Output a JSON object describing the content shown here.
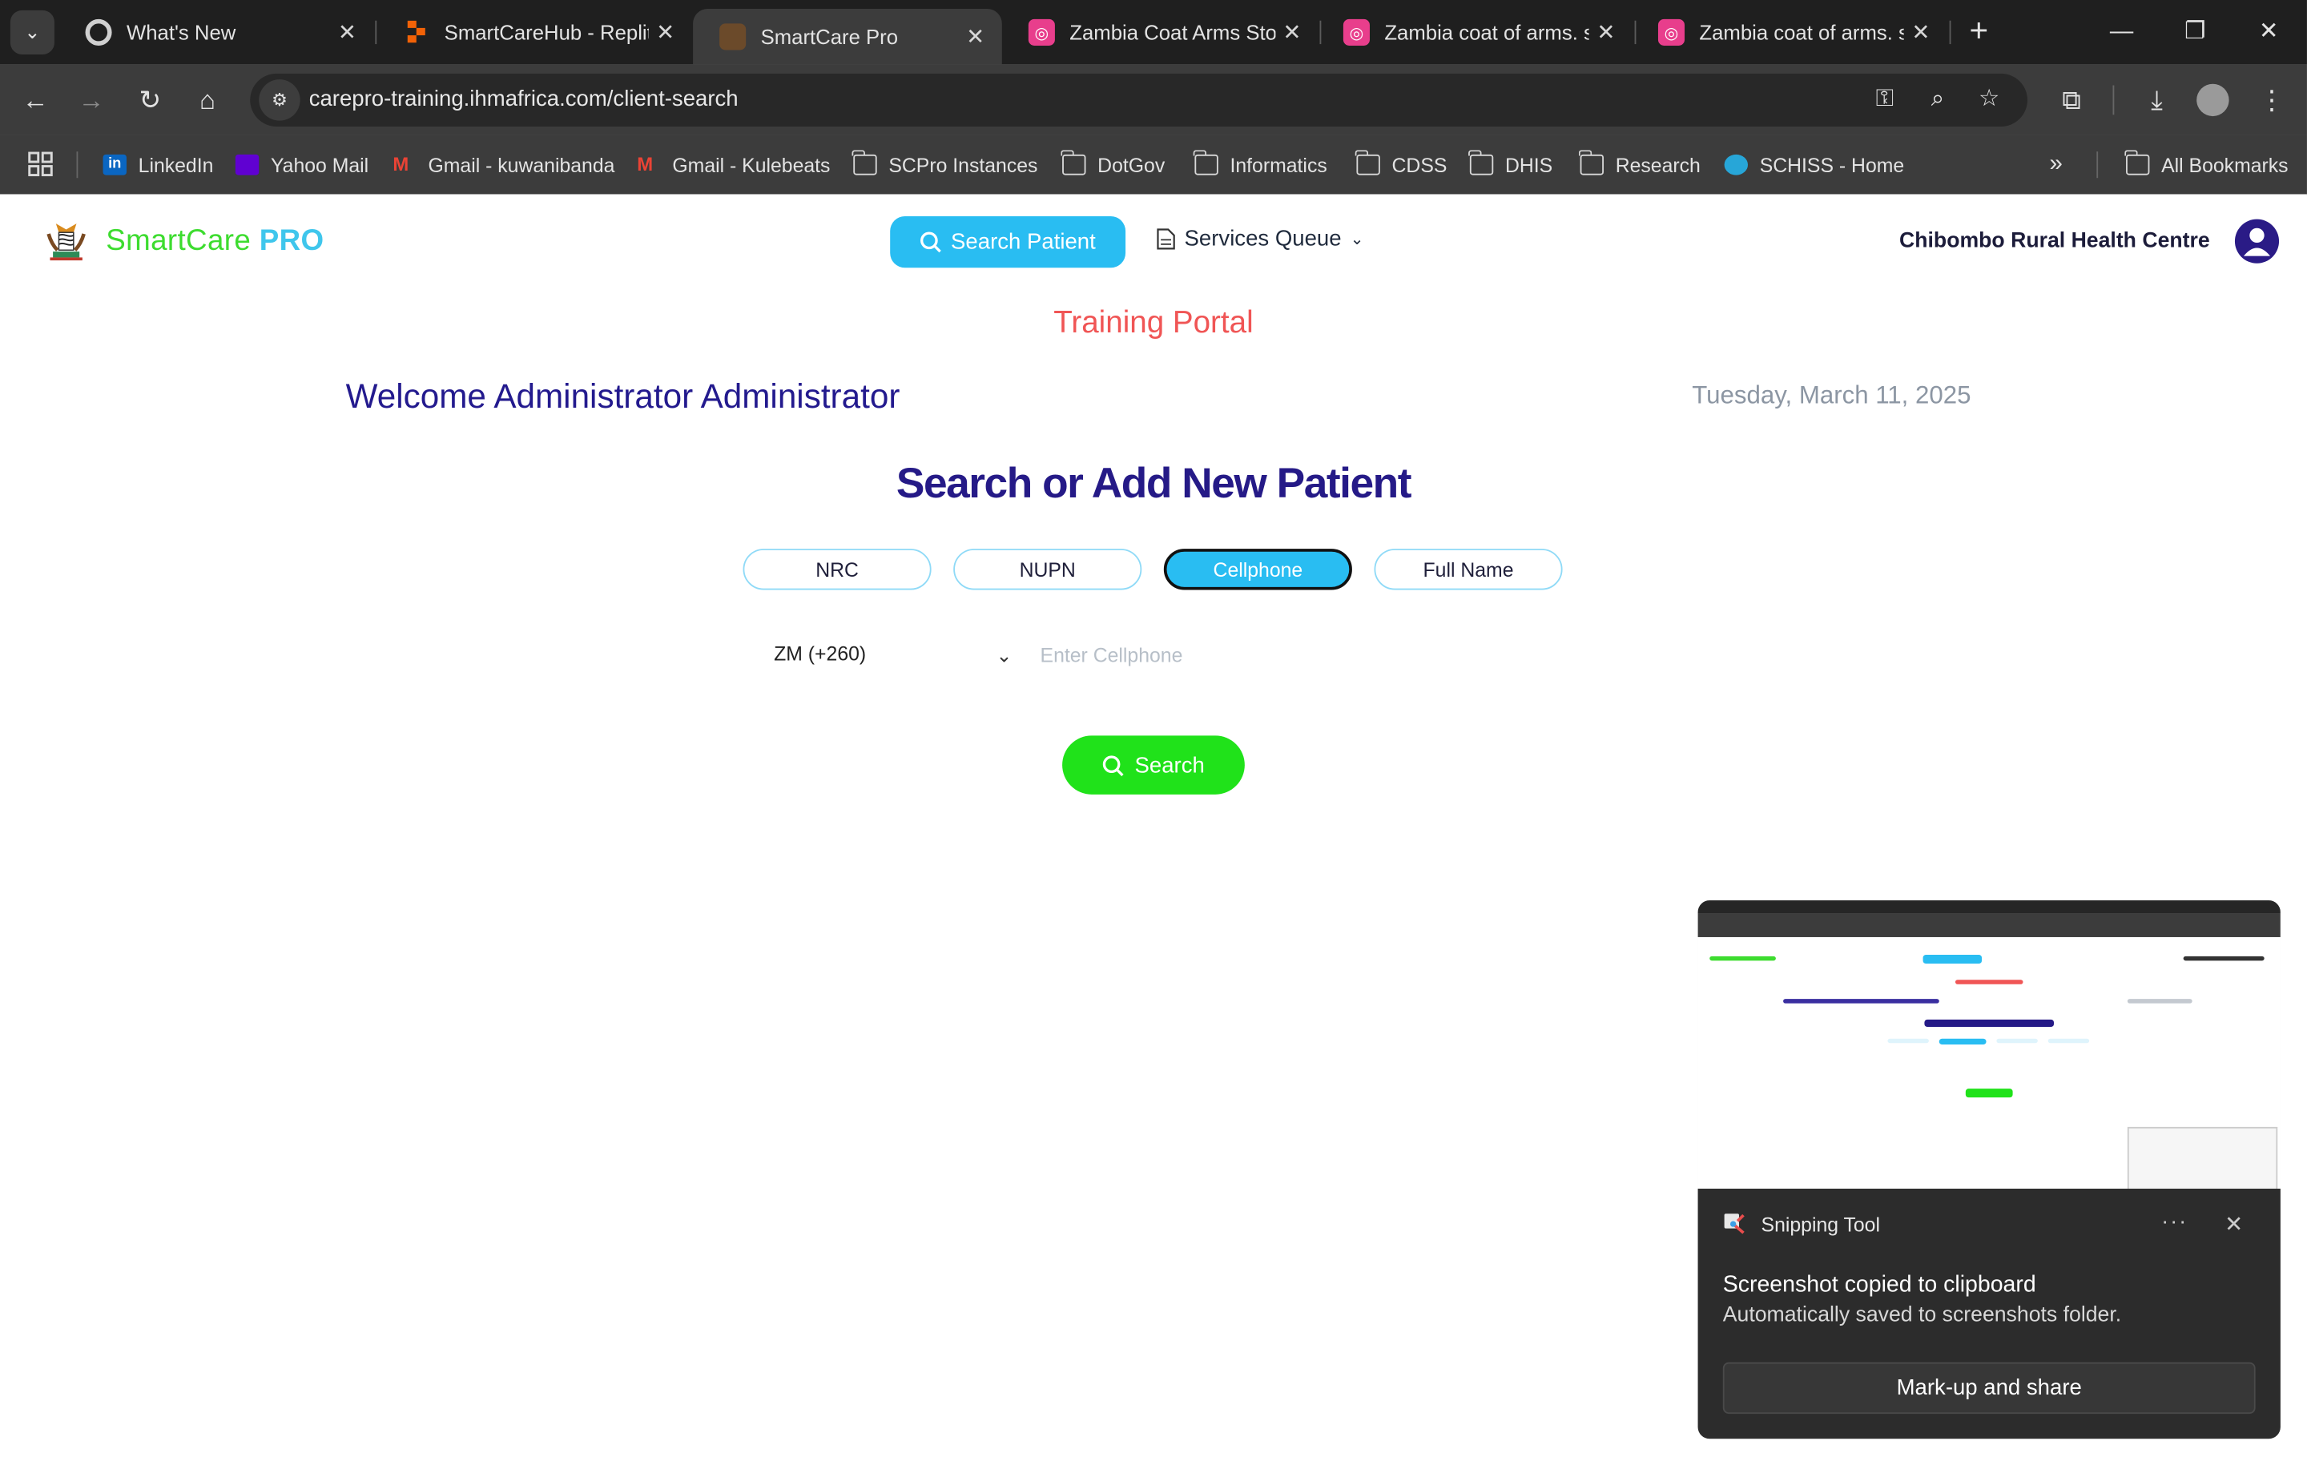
{
  "browser": {
    "tabs": [
      {
        "title": "What's New",
        "favicon": "chrome-icon",
        "active": false
      },
      {
        "title": "SmartCareHub - Replit",
        "favicon": "replit-icon",
        "active": false
      },
      {
        "title": "SmartCare Pro",
        "favicon": "zambia-coat-icon",
        "active": true
      },
      {
        "title": "Zambia Coat Arms Stock",
        "favicon": "stock-site-icon",
        "active": false
      },
      {
        "title": "Zambia coat of arms. st",
        "favicon": "stock-site-icon",
        "active": false
      },
      {
        "title": "Zambia coat of arms. st",
        "favicon": "stock-site-icon",
        "active": false
      }
    ],
    "url": "carepro-training.ihmafrica.com/client-search",
    "bookmarks": [
      {
        "label": "LinkedIn",
        "icon": "linkedin-icon"
      },
      {
        "label": "Yahoo Mail",
        "icon": "yahoo-mail-icon"
      },
      {
        "label": "Gmail - kuwanibanda",
        "icon": "gmail-icon"
      },
      {
        "label": "Gmail - Kulebeats",
        "icon": "gmail-icon"
      },
      {
        "label": "SCPro Instances",
        "icon": "folder-icon"
      },
      {
        "label": "DotGov",
        "icon": "folder-icon"
      },
      {
        "label": "Informatics",
        "icon": "folder-icon"
      },
      {
        "label": "CDSS",
        "icon": "folder-icon"
      },
      {
        "label": "DHIS",
        "icon": "folder-icon"
      },
      {
        "label": "Research",
        "icon": "folder-icon"
      },
      {
        "label": "SCHISS - Home",
        "icon": "schiss-icon"
      }
    ],
    "all_bookmarks": "All Bookmarks",
    "overflow": "»"
  },
  "app": {
    "logo_smart": "SmartCare",
    "logo_pro": " PRO",
    "nav_search_patient": "Search Patient",
    "nav_services_queue": "Services Queue",
    "facility": "Chibombo Rural Health Centre",
    "portal_label": "Training Portal",
    "welcome": "Welcome Administrator Administrator",
    "date": "Tuesday, March 11, 2025",
    "heading": "Search or Add New Patient",
    "search_types": [
      {
        "label": "NRC",
        "selected": false
      },
      {
        "label": "NUPN",
        "selected": false
      },
      {
        "label": "Cellphone",
        "selected": true
      },
      {
        "label": "Full Name",
        "selected": false
      }
    ],
    "country_code": "ZM (+260)",
    "phone_placeholder": "Enter Cellphone",
    "phone_value": "",
    "search_button": "Search"
  },
  "snipping_tool": {
    "app_name": "Snipping Tool",
    "more": "···",
    "title": "Screenshot copied to clipboard",
    "subtitle": "Automatically saved to screenshots folder.",
    "action": "Mark-up and share"
  },
  "colors": {
    "accent_blue": "#29bdf2",
    "search_green": "#20e21a",
    "heading_navy": "#251a87",
    "portal_red": "#f05555",
    "logo_green": "#3ddc2f"
  }
}
